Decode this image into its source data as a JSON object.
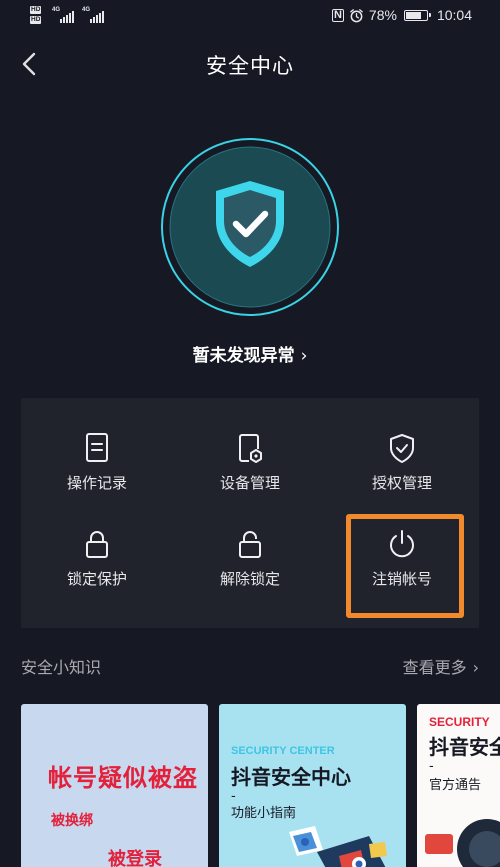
{
  "status_bar": {
    "network_1": "4G",
    "network_2": "4G",
    "battery_percent": "78%",
    "battery_level": 0.78,
    "time": "10:04",
    "icons": [
      "hd-icon",
      "signal-icon",
      "nfc-icon",
      "alarm-icon",
      "battery-icon"
    ]
  },
  "header": {
    "title": "安全中心",
    "back_icon": "chevron-left-icon"
  },
  "security_status": {
    "icon": "shield-check-icon",
    "text": "暂未发现异常",
    "chevron": "›"
  },
  "tools": [
    {
      "label": "操作记录",
      "icon": "document-icon"
    },
    {
      "label": "设备管理",
      "icon": "device-gear-icon"
    },
    {
      "label": "授权管理",
      "icon": "shield-check-small-icon"
    },
    {
      "label": "锁定保护",
      "icon": "lock-icon"
    },
    {
      "label": "解除锁定",
      "icon": "unlock-icon"
    },
    {
      "label": "注销帐号",
      "icon": "power-icon"
    }
  ],
  "knowledge": {
    "title": "安全小知识",
    "see_more": "查看更多",
    "chevron": "›",
    "cards": [
      {
        "title": "帐号疑似被盗",
        "line1": "被换绑",
        "line2": "被登录"
      },
      {
        "en": "SECURITY CENTER",
        "title": "抖音安全中心",
        "dash": "-",
        "subtitle": "功能小指南"
      },
      {
        "en": "SECURITY",
        "title": "抖音安全",
        "dash": "-",
        "subtitle": "官方通告"
      }
    ]
  },
  "colors": {
    "background": "#161823",
    "panel": "#20222c",
    "accent_cyan": "#38d3e6",
    "highlight_orange": "#f08a2c",
    "text_secondary": "#a9aab0"
  }
}
